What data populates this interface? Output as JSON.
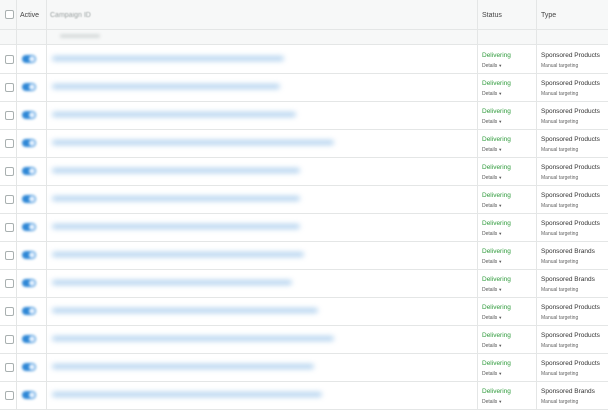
{
  "header": {
    "active_label": "Active",
    "campaign_label": "Campaign ID",
    "status_label": "Status",
    "type_label": "Type"
  },
  "colors": {
    "status_green": "#2f9b3c",
    "toggle_blue": "#2e87d6",
    "header_bg": "#f7f8f8",
    "border": "#e4e6e6"
  },
  "rows": [
    {
      "active": true,
      "status": "Delivering",
      "details": "Details",
      "type": "Sponsored Products",
      "targeting": "Manual targeting"
    },
    {
      "active": true,
      "status": "Delivering",
      "details": "Details",
      "type": "Sponsored Products",
      "targeting": "Manual targeting"
    },
    {
      "active": true,
      "status": "Delivering",
      "details": "Details",
      "type": "Sponsored Products",
      "targeting": "Manual targeting"
    },
    {
      "active": true,
      "status": "Delivering",
      "details": "Details",
      "type": "Sponsored Products",
      "targeting": "Manual targeting"
    },
    {
      "active": true,
      "status": "Delivering",
      "details": "Details",
      "type": "Sponsored Products",
      "targeting": "Manual targeting"
    },
    {
      "active": true,
      "status": "Delivering",
      "details": "Details",
      "type": "Sponsored Products",
      "targeting": "Manual targeting"
    },
    {
      "active": true,
      "status": "Delivering",
      "details": "Details",
      "type": "Sponsored Products",
      "targeting": "Manual targeting"
    },
    {
      "active": true,
      "status": "Delivering",
      "details": "Details",
      "type": "Sponsored Brands",
      "targeting": "Manual targeting"
    },
    {
      "active": true,
      "status": "Delivering",
      "details": "Details",
      "type": "Sponsored Brands",
      "targeting": "Manual targeting"
    },
    {
      "active": true,
      "status": "Delivering",
      "details": "Details",
      "type": "Sponsored Products",
      "targeting": "Manual targeting"
    },
    {
      "active": true,
      "status": "Delivering",
      "details": "Details",
      "type": "Sponsored Products",
      "targeting": "Manual targeting"
    },
    {
      "active": true,
      "status": "Delivering",
      "details": "Details",
      "type": "Sponsored Products",
      "targeting": "Manual targeting"
    },
    {
      "active": true,
      "status": "Delivering",
      "details": "Details",
      "type": "Sponsored Brands",
      "targeting": "Manual targeting"
    }
  ]
}
